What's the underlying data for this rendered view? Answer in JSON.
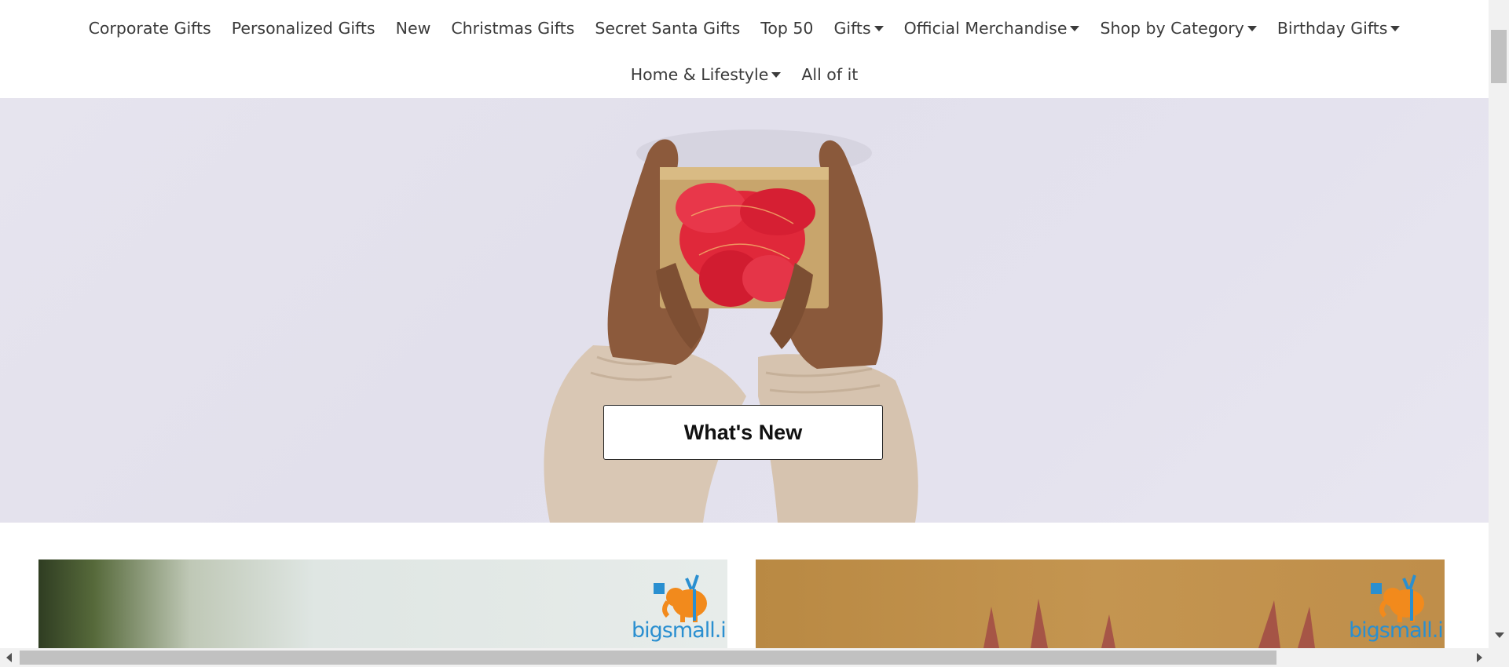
{
  "nav": {
    "row1": [
      {
        "label": "Corporate Gifts",
        "dropdown": false
      },
      {
        "label": "Personalized Gifts",
        "dropdown": false
      },
      {
        "label": "New",
        "dropdown": false
      },
      {
        "label": "Christmas Gifts",
        "dropdown": false
      },
      {
        "label": "Secret Santa Gifts",
        "dropdown": false
      },
      {
        "label": "Top 50",
        "dropdown": false
      },
      {
        "label": "Gifts",
        "dropdown": true
      },
      {
        "label": "Official Merchandise",
        "dropdown": true
      },
      {
        "label": "Shop by Category",
        "dropdown": true
      },
      {
        "label": "Birthday Gifts",
        "dropdown": true
      }
    ],
    "row2": [
      {
        "label": "Home & Lifestyle",
        "dropdown": true
      },
      {
        "label": "All of it",
        "dropdown": false
      }
    ]
  },
  "hero": {
    "button_label": "What's New"
  },
  "cards": [
    {
      "brand": "bigsmall.in",
      "logo_icon": "elephant-gift-logo-icon"
    },
    {
      "brand": "bigsmall.in",
      "logo_icon": "elephant-gift-logo-icon"
    }
  ],
  "colors": {
    "nav_text": "#3b3b3b",
    "hero_bg": "#e4e2ee",
    "ribbon": "#e0283a",
    "brand_blue": "#2a8fd0",
    "brand_orange": "#f28a1c"
  }
}
